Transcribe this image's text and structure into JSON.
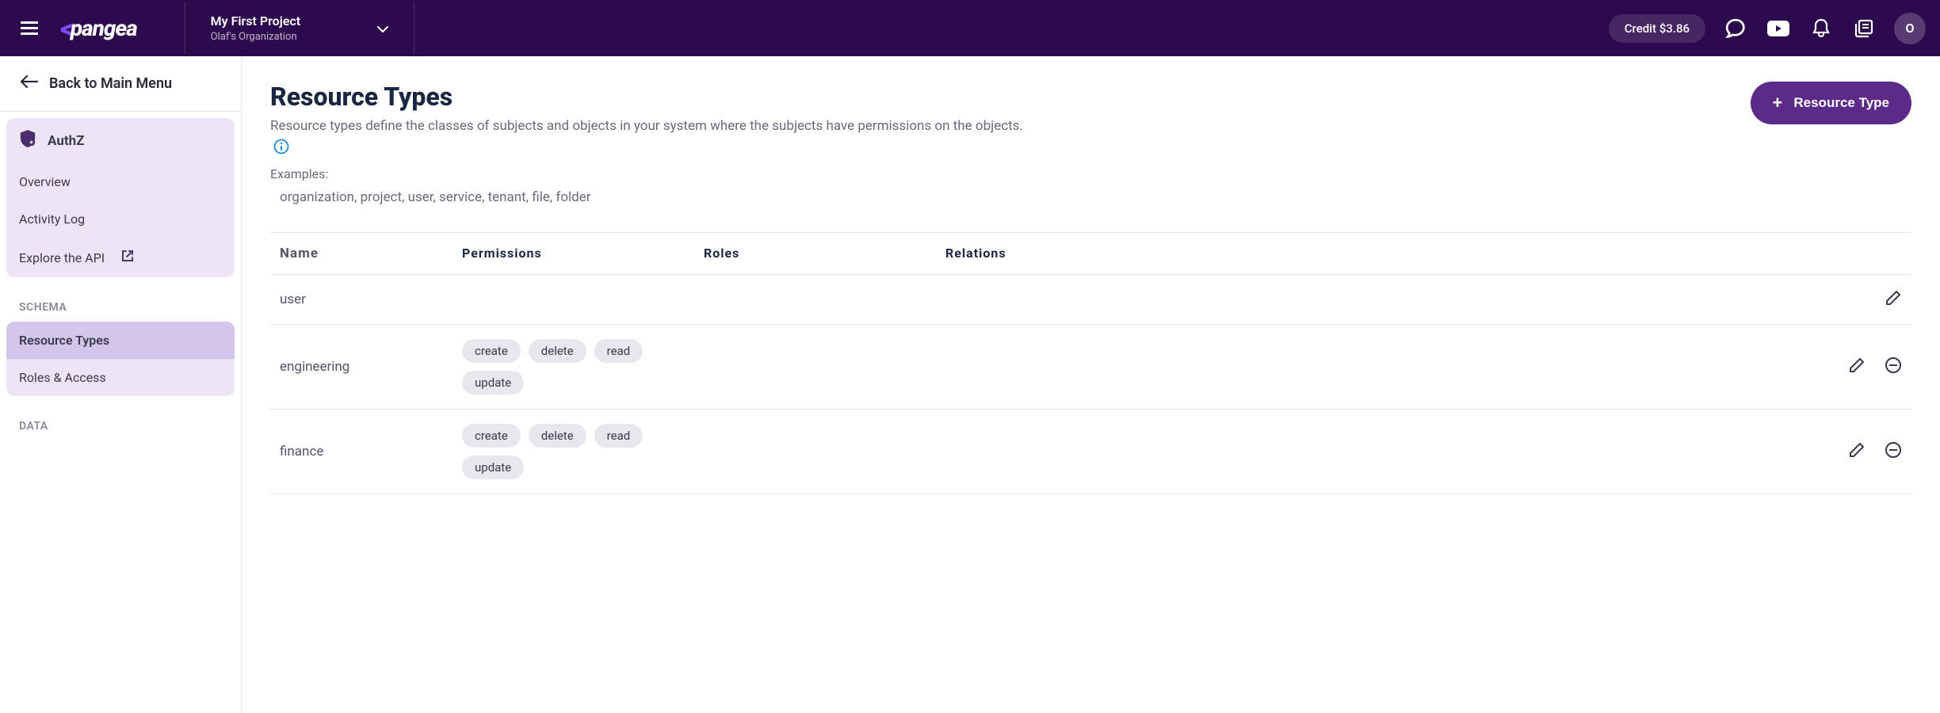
{
  "header": {
    "logo_text": "pangea",
    "project_name": "My First Project",
    "org_name": "Olaf's Organization",
    "credit_label": "Credit $3.86",
    "avatar_initial": "O"
  },
  "sidebar": {
    "back_label": "Back to Main Menu",
    "service_label": "AuthZ",
    "items": {
      "overview": "Overview",
      "activity_log": "Activity Log",
      "explore_api": "Explore the API"
    },
    "headings": {
      "schema": "SCHEMA",
      "data": "DATA"
    },
    "schema_items": {
      "resource_types": "Resource Types",
      "roles_access": "Roles & Access"
    }
  },
  "page": {
    "title": "Resource Types",
    "subtitle": "Resource types define the classes of subjects and objects in your system where the subjects have permissions on the objects.",
    "examples_label": "Examples:",
    "examples_list": "organization, project, user, service, tenant, file, folder",
    "button_label": "Resource Type"
  },
  "table": {
    "columns": {
      "name": "Name",
      "permissions": "Permissions",
      "roles": "Roles",
      "relations": "Relations"
    },
    "rows": [
      {
        "name": "user",
        "permissions": [],
        "show_delete": false
      },
      {
        "name": "engineering",
        "permissions": [
          "create",
          "delete",
          "read",
          "update"
        ],
        "show_delete": true
      },
      {
        "name": "finance",
        "permissions": [
          "create",
          "delete",
          "read",
          "update"
        ],
        "show_delete": true
      }
    ]
  }
}
